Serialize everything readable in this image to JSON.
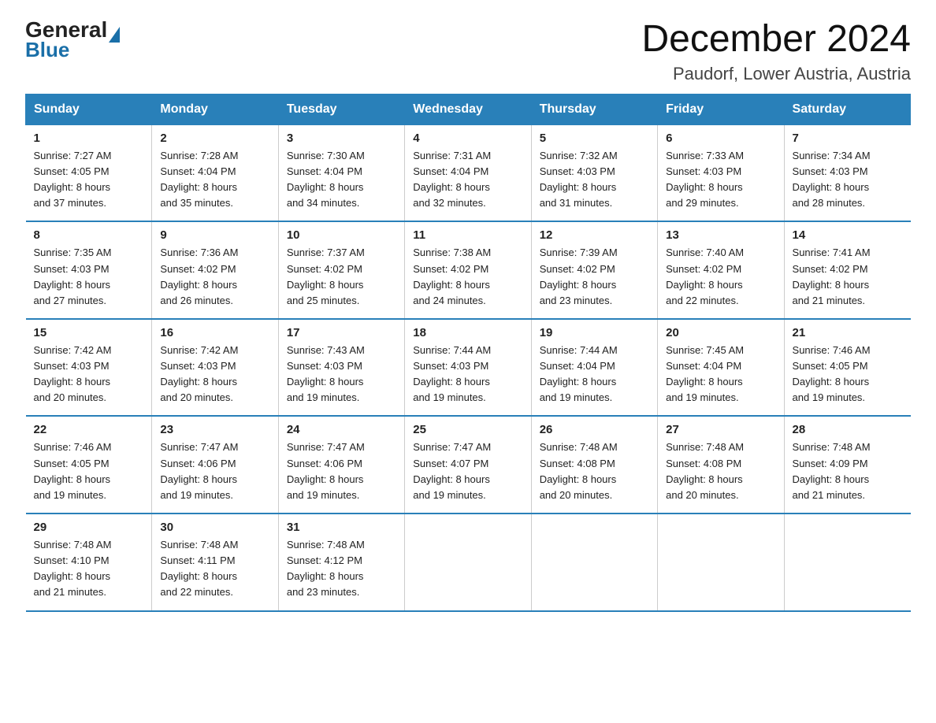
{
  "header": {
    "logo_general": "General",
    "logo_blue": "Blue",
    "month_title": "December 2024",
    "location": "Paudorf, Lower Austria, Austria"
  },
  "days_of_week": [
    "Sunday",
    "Monday",
    "Tuesday",
    "Wednesday",
    "Thursday",
    "Friday",
    "Saturday"
  ],
  "weeks": [
    [
      {
        "day": "1",
        "sunrise": "7:27 AM",
        "sunset": "4:05 PM",
        "daylight": "8 hours and 37 minutes."
      },
      {
        "day": "2",
        "sunrise": "7:28 AM",
        "sunset": "4:04 PM",
        "daylight": "8 hours and 35 minutes."
      },
      {
        "day": "3",
        "sunrise": "7:30 AM",
        "sunset": "4:04 PM",
        "daylight": "8 hours and 34 minutes."
      },
      {
        "day": "4",
        "sunrise": "7:31 AM",
        "sunset": "4:04 PM",
        "daylight": "8 hours and 32 minutes."
      },
      {
        "day": "5",
        "sunrise": "7:32 AM",
        "sunset": "4:03 PM",
        "daylight": "8 hours and 31 minutes."
      },
      {
        "day": "6",
        "sunrise": "7:33 AM",
        "sunset": "4:03 PM",
        "daylight": "8 hours and 29 minutes."
      },
      {
        "day": "7",
        "sunrise": "7:34 AM",
        "sunset": "4:03 PM",
        "daylight": "8 hours and 28 minutes."
      }
    ],
    [
      {
        "day": "8",
        "sunrise": "7:35 AM",
        "sunset": "4:03 PM",
        "daylight": "8 hours and 27 minutes."
      },
      {
        "day": "9",
        "sunrise": "7:36 AM",
        "sunset": "4:02 PM",
        "daylight": "8 hours and 26 minutes."
      },
      {
        "day": "10",
        "sunrise": "7:37 AM",
        "sunset": "4:02 PM",
        "daylight": "8 hours and 25 minutes."
      },
      {
        "day": "11",
        "sunrise": "7:38 AM",
        "sunset": "4:02 PM",
        "daylight": "8 hours and 24 minutes."
      },
      {
        "day": "12",
        "sunrise": "7:39 AM",
        "sunset": "4:02 PM",
        "daylight": "8 hours and 23 minutes."
      },
      {
        "day": "13",
        "sunrise": "7:40 AM",
        "sunset": "4:02 PM",
        "daylight": "8 hours and 22 minutes."
      },
      {
        "day": "14",
        "sunrise": "7:41 AM",
        "sunset": "4:02 PM",
        "daylight": "8 hours and 21 minutes."
      }
    ],
    [
      {
        "day": "15",
        "sunrise": "7:42 AM",
        "sunset": "4:03 PM",
        "daylight": "8 hours and 20 minutes."
      },
      {
        "day": "16",
        "sunrise": "7:42 AM",
        "sunset": "4:03 PM",
        "daylight": "8 hours and 20 minutes."
      },
      {
        "day": "17",
        "sunrise": "7:43 AM",
        "sunset": "4:03 PM",
        "daylight": "8 hours and 19 minutes."
      },
      {
        "day": "18",
        "sunrise": "7:44 AM",
        "sunset": "4:03 PM",
        "daylight": "8 hours and 19 minutes."
      },
      {
        "day": "19",
        "sunrise": "7:44 AM",
        "sunset": "4:04 PM",
        "daylight": "8 hours and 19 minutes."
      },
      {
        "day": "20",
        "sunrise": "7:45 AM",
        "sunset": "4:04 PM",
        "daylight": "8 hours and 19 minutes."
      },
      {
        "day": "21",
        "sunrise": "7:46 AM",
        "sunset": "4:05 PM",
        "daylight": "8 hours and 19 minutes."
      }
    ],
    [
      {
        "day": "22",
        "sunrise": "7:46 AM",
        "sunset": "4:05 PM",
        "daylight": "8 hours and 19 minutes."
      },
      {
        "day": "23",
        "sunrise": "7:47 AM",
        "sunset": "4:06 PM",
        "daylight": "8 hours and 19 minutes."
      },
      {
        "day": "24",
        "sunrise": "7:47 AM",
        "sunset": "4:06 PM",
        "daylight": "8 hours and 19 minutes."
      },
      {
        "day": "25",
        "sunrise": "7:47 AM",
        "sunset": "4:07 PM",
        "daylight": "8 hours and 19 minutes."
      },
      {
        "day": "26",
        "sunrise": "7:48 AM",
        "sunset": "4:08 PM",
        "daylight": "8 hours and 20 minutes."
      },
      {
        "day": "27",
        "sunrise": "7:48 AM",
        "sunset": "4:08 PM",
        "daylight": "8 hours and 20 minutes."
      },
      {
        "day": "28",
        "sunrise": "7:48 AM",
        "sunset": "4:09 PM",
        "daylight": "8 hours and 21 minutes."
      }
    ],
    [
      {
        "day": "29",
        "sunrise": "7:48 AM",
        "sunset": "4:10 PM",
        "daylight": "8 hours and 21 minutes."
      },
      {
        "day": "30",
        "sunrise": "7:48 AM",
        "sunset": "4:11 PM",
        "daylight": "8 hours and 22 minutes."
      },
      {
        "day": "31",
        "sunrise": "7:48 AM",
        "sunset": "4:12 PM",
        "daylight": "8 hours and 23 minutes."
      },
      null,
      null,
      null,
      null
    ]
  ],
  "labels": {
    "sunrise": "Sunrise:",
    "sunset": "Sunset:",
    "daylight": "Daylight:"
  }
}
